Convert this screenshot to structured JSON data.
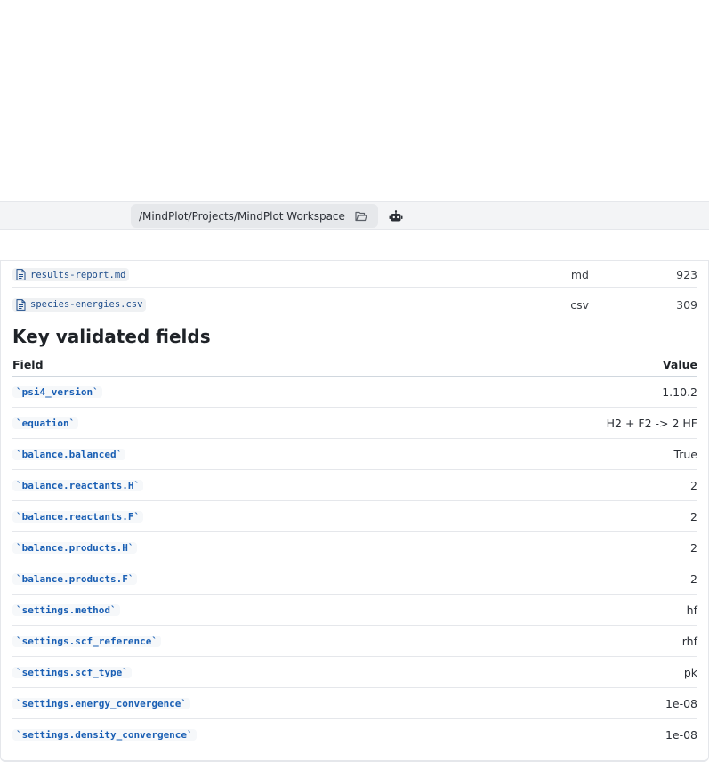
{
  "toolbar": {
    "path": "/MindPlot/Projects/MindPlot Workspace",
    "folder_icon": "folder-open-icon",
    "bot_icon": "robot-icon"
  },
  "files": [
    {
      "name": "results-report.md",
      "ext": "md",
      "size": "923"
    },
    {
      "name": "species-energies.csv",
      "ext": "csv",
      "size": "309"
    }
  ],
  "section": {
    "title": "Key validated fields"
  },
  "table": {
    "col_field": "Field",
    "col_value": "Value",
    "rows": [
      {
        "key": "`psi4_version`",
        "value": "1.10.2"
      },
      {
        "key": "`equation`",
        "value": "H2 + F2 -> 2 HF"
      },
      {
        "key": "`balance.balanced`",
        "value": "True"
      },
      {
        "key": "`balance.reactants.H`",
        "value": "2"
      },
      {
        "key": "`balance.reactants.F`",
        "value": "2"
      },
      {
        "key": "`balance.products.H`",
        "value": "2"
      },
      {
        "key": "`balance.products.F`",
        "value": "2"
      },
      {
        "key": "`settings.method`",
        "value": "hf"
      },
      {
        "key": "`settings.scf_reference`",
        "value": "rhf"
      },
      {
        "key": "`settings.scf_type`",
        "value": "pk"
      },
      {
        "key": "`settings.energy_convergence`",
        "value": "1e-08"
      },
      {
        "key": "`settings.density_convergence`",
        "value": "1e-08"
      }
    ]
  }
}
